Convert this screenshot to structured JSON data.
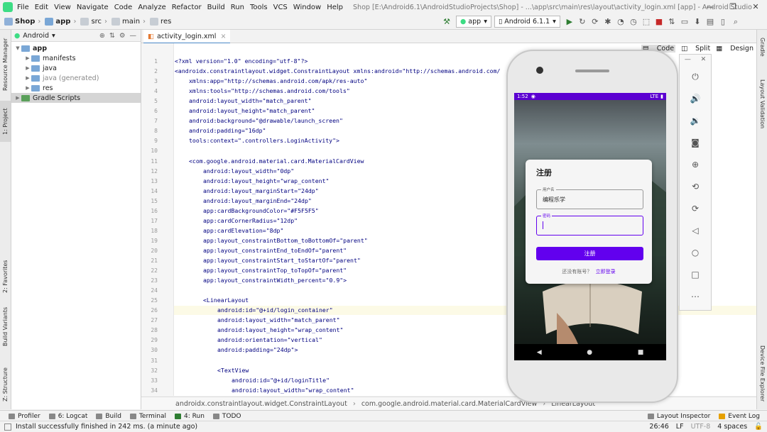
{
  "titlebar": {
    "menu": [
      "File",
      "Edit",
      "View",
      "Navigate",
      "Code",
      "Analyze",
      "Refactor",
      "Build",
      "Run",
      "Tools",
      "VCS",
      "Window",
      "Help"
    ],
    "title": "Shop [E:\\Android6.1\\AndroidStudioProjects\\Shop] - ...\\app\\src\\main\\res\\layout\\activity_login.xml [app] - Android Studio"
  },
  "navbar": {
    "crumbs": [
      "Shop",
      "app",
      "src",
      "main",
      "res"
    ],
    "run_config": "app",
    "device": "Android 6.1.1"
  },
  "leftstrip": {
    "tabs": [
      "Resource Manager",
      "1: Project",
      "2: Favorites",
      "Build Variants",
      "Z: Structure"
    ]
  },
  "rightstrip": {
    "tabs": [
      "Gradle",
      "Layout Validation",
      "Device File Explorer"
    ]
  },
  "project": {
    "view": "Android",
    "tree": [
      {
        "label": "app",
        "level": 0,
        "bold": true
      },
      {
        "label": "manifests",
        "level": 1
      },
      {
        "label": "java",
        "level": 1
      },
      {
        "label": "java (generated)",
        "level": 1
      },
      {
        "label": "res",
        "level": 1
      },
      {
        "label": "Gradle Scripts",
        "level": 0
      }
    ]
  },
  "editor": {
    "tab": "activity_login.xml",
    "view_modes": [
      "Code",
      "Split",
      "Design"
    ],
    "line_numbers": [
      "1",
      "2",
      "3",
      "4",
      "5",
      "6",
      "7",
      "8",
      "9",
      "10",
      "11",
      "12",
      "13",
      "14",
      "15",
      "16",
      "17",
      "18",
      "19",
      "20",
      "21",
      "22",
      "23",
      "24",
      "25",
      "26",
      "27",
      "28",
      "29",
      "30",
      "31",
      "32",
      "33",
      "34"
    ],
    "lines": [
      {
        "i": 0,
        "t": "<?xml version=\"1.0\" encoding=\"utf-8\"?>"
      },
      {
        "i": 0,
        "t": "<androidx.constraintlayout.widget.ConstraintLayout xmlns:android=\"http://schemas.android.com/"
      },
      {
        "i": 2,
        "t": "xmlns:app=\"http://schemas.android.com/apk/res-auto\""
      },
      {
        "i": 2,
        "t": "xmlns:tools=\"http://schemas.android.com/tools\""
      },
      {
        "i": 2,
        "t": "android:layout_width=\"match_parent\""
      },
      {
        "i": 2,
        "t": "android:layout_height=\"match_parent\""
      },
      {
        "i": 2,
        "t": "android:background=\"@drawable/launch_screen\""
      },
      {
        "i": 2,
        "t": "android:padding=\"16dp\""
      },
      {
        "i": 2,
        "t": "tools:context=\".controllers.LoginActivity\">"
      },
      {
        "i": 0,
        "t": ""
      },
      {
        "i": 2,
        "t": "<com.google.android.material.card.MaterialCardView"
      },
      {
        "i": 4,
        "t": "android:layout_width=\"0dp\""
      },
      {
        "i": 4,
        "t": "android:layout_height=\"wrap_content\""
      },
      {
        "i": 4,
        "t": "android:layout_marginStart=\"24dp\""
      },
      {
        "i": 4,
        "t": "android:layout_marginEnd=\"24dp\""
      },
      {
        "i": 4,
        "t": "app:cardBackgroundColor=\"#F5F5F5\""
      },
      {
        "i": 4,
        "t": "app:cardCornerRadius=\"12dp\""
      },
      {
        "i": 4,
        "t": "app:cardElevation=\"8dp\""
      },
      {
        "i": 4,
        "t": "app:layout_constraintBottom_toBottomOf=\"parent\""
      },
      {
        "i": 4,
        "t": "app:layout_constraintEnd_toEndOf=\"parent\""
      },
      {
        "i": 4,
        "t": "app:layout_constraintStart_toStartOf=\"parent\""
      },
      {
        "i": 4,
        "t": "app:layout_constraintTop_toTopOf=\"parent\""
      },
      {
        "i": 4,
        "t": "app:layout_constraintWidth_percent=\"0.9\">"
      },
      {
        "i": 0,
        "t": ""
      },
      {
        "i": 4,
        "t": "<LinearLayout"
      },
      {
        "i": 6,
        "t": "android:id=\"@+id/login_container\""
      },
      {
        "i": 6,
        "t": "android:layout_width=\"match_parent\""
      },
      {
        "i": 6,
        "t": "android:layout_height=\"wrap_content\""
      },
      {
        "i": 6,
        "t": "android:orientation=\"vertical\""
      },
      {
        "i": 6,
        "t": "android:padding=\"24dp\">"
      },
      {
        "i": 0,
        "t": ""
      },
      {
        "i": 6,
        "t": "<TextView"
      },
      {
        "i": 8,
        "t": "android:id=\"@+id/loginTitle\""
      },
      {
        "i": 8,
        "t": "android:layout_width=\"wrap_content\""
      }
    ]
  },
  "breadcrumb": [
    "androidx.constraintlayout.widget.ConstraintLayout",
    "com.google.android.material.card.MaterialCardView",
    "LinearLayout"
  ],
  "bottom_tools": [
    "Profiler",
    "6: Logcat",
    "Build",
    "Terminal",
    "4: Run",
    "TODO"
  ],
  "bottom_right_tools": [
    "Layout Inspector",
    "Event Log"
  ],
  "status": {
    "message": "Install successfully finished in 242 ms. (a minute ago)",
    "position": "26:46",
    "line_sep": "LF",
    "encoding": "UTF-8",
    "indent": "4 spaces"
  },
  "phone": {
    "time": "1:52",
    "signal": "LTE",
    "card_title": "注册",
    "username_label": "用户名",
    "username_value": "编程乐学",
    "password_label": "密码",
    "register_button": "注册",
    "no_account_text": "还没有账号？",
    "login_link": "立即登录",
    "accent": "#6200ee"
  },
  "emulator_controls": [
    "power-icon",
    "volume-up-icon",
    "volume-down-icon",
    "camera-icon",
    "zoom-icon",
    "rotate-left-icon",
    "rotate-right-icon",
    "back-icon",
    "home-icon",
    "overview-icon",
    "more-icon"
  ]
}
